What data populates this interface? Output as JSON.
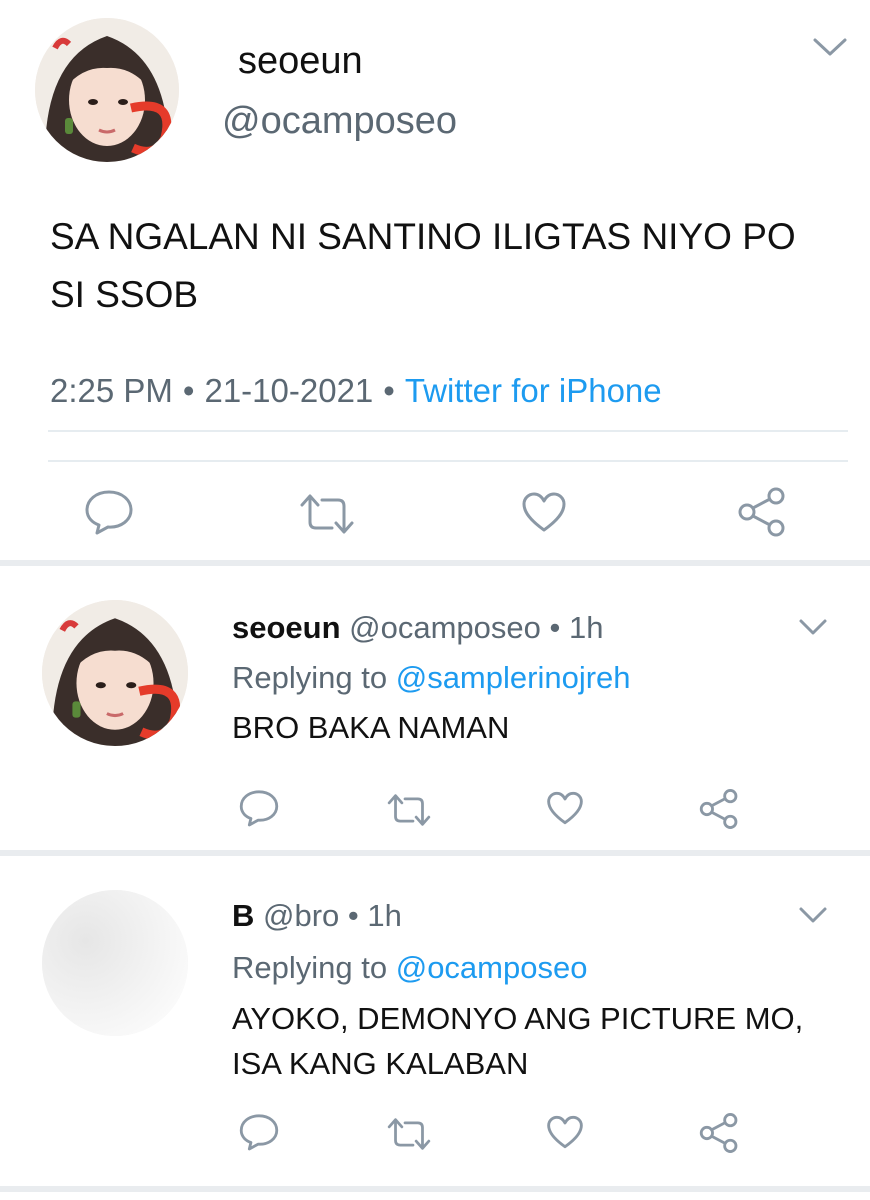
{
  "main_tweet": {
    "display_name": "seoeun",
    "handle": "@ocamposeo",
    "text": "SA NGALAN NI SANTINO ILIGTAS NIYO PO SI SSOB",
    "time": "2:25 PM",
    "date": "21-10-2021",
    "source": "Twitter for iPhone"
  },
  "replies": [
    {
      "display_name": "seoeun",
      "handle": "@ocamposeo",
      "age": "1h",
      "replying_label": "Replying to",
      "replying_to": "@samplerinojreh",
      "text": "BRO BAKA NAMAN"
    },
    {
      "display_name": "B",
      "handle": "@bro",
      "age": "1h",
      "replying_label": "Replying to",
      "replying_to": "@ocamposeo",
      "text": "AYOKO, DEMONYO ANG PICTURE MO, ISA KANG KALABAN"
    }
  ],
  "separator_dot": "•",
  "icons": {
    "reply": "reply-icon",
    "retweet": "retweet-icon",
    "like": "heart-icon",
    "share": "share-icon",
    "menu": "chevron-down-icon"
  },
  "colors": {
    "accent": "#1d9bf0",
    "secondary_text": "#5b6873",
    "icon_gray": "#8b98a5"
  }
}
